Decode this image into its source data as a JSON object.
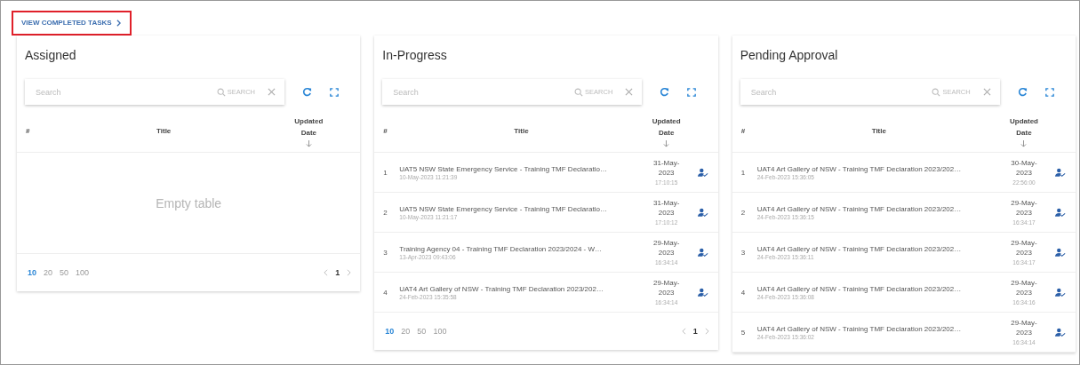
{
  "link": {
    "label": "VIEW COMPLETED TASKS",
    "highlighted": true
  },
  "panels": [
    {
      "title": "Assigned",
      "search": {
        "placeholder": "Search",
        "button": "SEARCH"
      },
      "columns": [
        "#",
        "Title",
        "Updated Date"
      ],
      "empty_text": "Empty table",
      "page_sizes": [
        {
          "label": "10",
          "selected": true
        },
        {
          "label": "20",
          "selected": false
        },
        {
          "label": "50",
          "selected": false
        },
        {
          "label": "100",
          "selected": false
        }
      ],
      "page": "1"
    },
    {
      "title": "In-Progress",
      "search": {
        "placeholder": "Search",
        "button": "SEARCH"
      },
      "columns": [
        "#",
        "Title",
        "Updated Date"
      ],
      "rows": [
        {
          "number": "1",
          "title": "UAT5 NSW State Emergency Service - Training TMF Declaratio…",
          "created": "10-May-2023 11:21:39",
          "updated_date": "31-May-2023",
          "updated_time": "17:10:15"
        },
        {
          "number": "2",
          "title": "UAT5 NSW State Emergency Service - Training TMF Declaratio…",
          "created": "10-May-2023 11:21:17",
          "updated_date": "31-May-2023",
          "updated_time": "17:10:12"
        },
        {
          "number": "3",
          "title": "Training Agency 04 - Training TMF Declaration 2023/2024 - W…",
          "created": "13-Apr-2023 09:43:06",
          "updated_date": "29-May-2023",
          "updated_time": "16:34:14"
        },
        {
          "number": "4",
          "title": "UAT4 Art Gallery of NSW - Training TMF Declaration 2023/202…",
          "created": "24-Feb-2023 15:35:58",
          "updated_date": "29-May-2023",
          "updated_time": "16:34:14"
        }
      ],
      "page_sizes": [
        {
          "label": "10",
          "selected": true
        },
        {
          "label": "20",
          "selected": false
        },
        {
          "label": "50",
          "selected": false
        },
        {
          "label": "100",
          "selected": false
        }
      ],
      "page": "1"
    },
    {
      "title": "Pending Approval",
      "search": {
        "placeholder": "Search",
        "button": "SEARCH"
      },
      "columns": [
        "#",
        "Title",
        "Updated Date"
      ],
      "rows": [
        {
          "number": "1",
          "title": "UAT4 Art Gallery of NSW - Training TMF Declaration 2023/202…",
          "created": "24-Feb-2023 15:36:05",
          "updated_date": "30-May-2023",
          "updated_time": "22:56:00"
        },
        {
          "number": "2",
          "title": "UAT4 Art Gallery of NSW - Training TMF Declaration 2023/202…",
          "created": "24-Feb-2023 15:36:15",
          "updated_date": "29-May-2023",
          "updated_time": "16:34:17"
        },
        {
          "number": "3",
          "title": "UAT4 Art Gallery of NSW - Training TMF Declaration 2023/202…",
          "created": "24-Feb-2023 15:36:11",
          "updated_date": "29-May-2023",
          "updated_time": "16:34:17"
        },
        {
          "number": "4",
          "title": "UAT4 Art Gallery of NSW - Training TMF Declaration 2023/202…",
          "created": "24-Feb-2023 15:36:08",
          "updated_date": "29-May-2023",
          "updated_time": "16:34:16"
        },
        {
          "number": "5",
          "title": "UAT4 Art Gallery of NSW - Training TMF Declaration 2023/202…",
          "created": "24-Feb-2023 15:36:02",
          "updated_date": "29-May-2023",
          "updated_time": "16:34:14"
        }
      ]
    }
  ]
}
